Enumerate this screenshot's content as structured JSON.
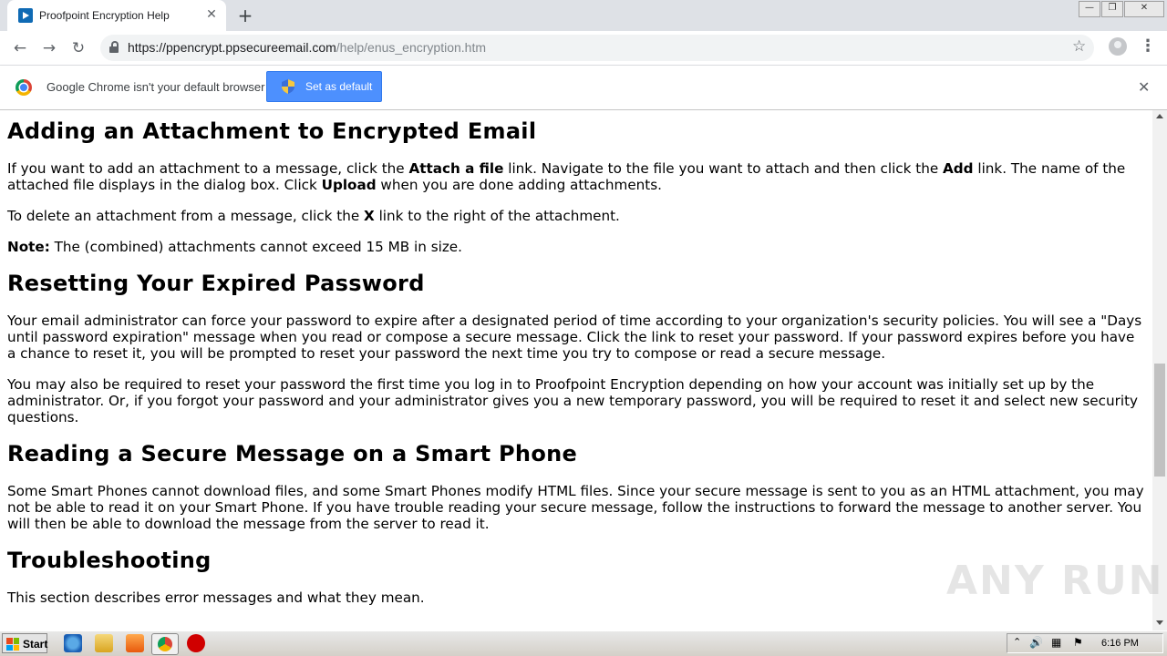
{
  "tab": {
    "title": "Proofpoint Encryption Help",
    "close": "✕"
  },
  "window": {
    "minimize": "—",
    "restore": "❐",
    "close": "✕"
  },
  "toolbar": {
    "back": "←",
    "forward": "→",
    "reload": "↻",
    "url_host": "https://ppencrypt.ppsecureemail.com",
    "url_path": "/help/enus_encryption.htm",
    "star": "☆",
    "menu": "⋮"
  },
  "infobar": {
    "message": "Google Chrome isn't your default browser",
    "button_label": "Set as default",
    "close": "✕"
  },
  "content": {
    "attach": {
      "heading": "Adding an Attachment to Encrypted Email",
      "p1_a": "If you want to add an attachment to a message, click the ",
      "p1_b": "Attach a file",
      "p1_c": " link. Navigate to the file you want to attach and then click the ",
      "p1_d": "Add",
      "p1_e": " link. The name of the attached file displays in the dialog box. Click ",
      "p1_f": "Upload",
      "p1_g": " when you are done adding attachments.",
      "p2_a": "To delete an attachment from a message, click the ",
      "p2_b": "X",
      "p2_c": " link to the right of the attachment.",
      "note_label": "Note:",
      "note_text": " The (combined) attachments cannot exceed 15 MB in size."
    },
    "reset": {
      "heading": "Resetting Your Expired Password",
      "p1": "Your email administrator can force your password to expire after a designated period of time according to your organization's security policies. You will see a \"Days until password expiration\" message when you read or compose a secure message. Click the link to reset your password. If your password expires before you have a chance to reset it, you will be prompted to reset your password the next time you try to compose or read a secure message.",
      "p2": "You may also be required to reset your password the first time you log in to Proofpoint Encryption depending on how your account was initially set up by the administrator. Or, if you forgot your password and your administrator gives you a new temporary password, you will be required to reset it and select new security questions."
    },
    "smartphone": {
      "heading": "Reading a Secure Message on a Smart Phone",
      "p1": "Some Smart Phones cannot download files, and some Smart Phones modify HTML files. Since your secure message is sent to you as an HTML attachment, you may not be able to read it on your Smart Phone. If you have trouble reading your secure message, follow the instructions to forward the message to another server. You will then be able to download the message from the server to read it."
    },
    "troubleshooting": {
      "heading": "Troubleshooting",
      "p1": "This section describes error messages and what they mean."
    }
  },
  "watermark": "ANY RUN",
  "taskbar": {
    "start": "Start",
    "clock": "6:16 PM"
  },
  "colors": {
    "accent": "#4d90fe",
    "tab_bg": "#dee1e6"
  }
}
